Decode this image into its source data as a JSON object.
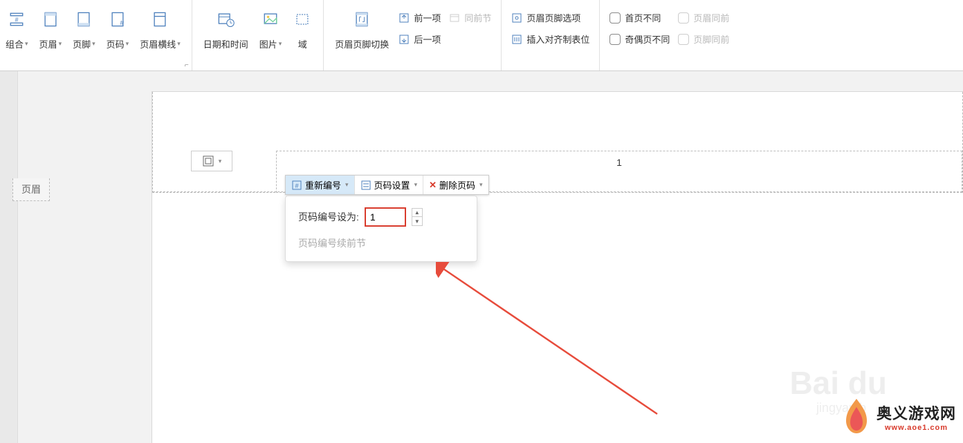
{
  "ribbon": {
    "group1": {
      "combo": "组合",
      "header": "页眉",
      "footer": "页脚",
      "pagenum": "页码",
      "headerline": "页眉横线"
    },
    "group2": {
      "datetime": "日期和时间",
      "picture": "图片",
      "field": "域"
    },
    "group3": {
      "switch": "页眉页脚切换",
      "prev": "前一项",
      "next": "后一项",
      "sameprev": "同前节"
    },
    "group4": {
      "options": "页眉页脚选项",
      "align": "插入对齐制表位"
    },
    "group5": {
      "firstdiff": "首页不同",
      "oddeven": "奇偶页不同",
      "headersame": "页眉同前",
      "footersame": "页脚同前"
    }
  },
  "page": {
    "number": "1"
  },
  "tag": {
    "header": "页眉"
  },
  "mini": {
    "renumber": "重新编号",
    "settings": "页码设置",
    "delete": "删除页码"
  },
  "popup": {
    "label": "页码编号设为:",
    "value": "1",
    "continue": "页码编号续前节"
  },
  "watermark": {
    "brand": "Bai du",
    "sub": "jingyan.b"
  },
  "logo": {
    "main": "奥义游戏网",
    "sub": "www.aoe1.com"
  }
}
